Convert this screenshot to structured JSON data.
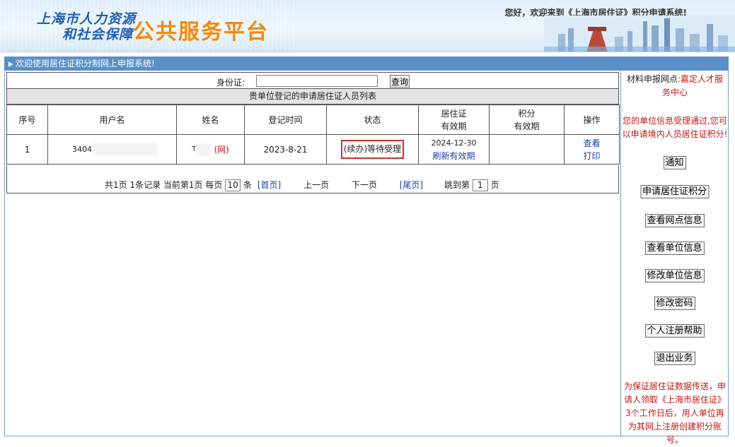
{
  "header": {
    "logo_line1": "上海市人力资源",
    "logo_line2": "和社会保障",
    "logo_main": "公共服务平台",
    "welcome": "您好，欢迎来到《上海市居住证》积分申请系统!"
  },
  "titlebar": {
    "text": "欢迎使用居住证积分制网上申报系统!"
  },
  "search": {
    "label": "身份证:",
    "value": "",
    "button": "查询"
  },
  "list_title": "贵单位登记的申请居住证人员列表",
  "table": {
    "headers": [
      "序号",
      "用户名",
      "姓名",
      "登记时间",
      "状态",
      "居住证有效期",
      "积分有效期",
      "操作"
    ],
    "headers_lines": {
      "permit_1": "居住证",
      "permit_2": "有效期",
      "score_1": "积分",
      "score_2": "有效期"
    },
    "rows": [
      {
        "index": "1",
        "username": "3404",
        "name": "T",
        "name_tag": "(网)",
        "reg_time": "2023-8-21",
        "status": "(续办)等待受理",
        "permit_expiry": "2024-12-30",
        "permit_refresh": "刷新有效期",
        "score_expiry": "",
        "op_view": "查看",
        "op_print": "打印"
      }
    ]
  },
  "pager": {
    "summary": "共1页 1条记录 当前第1页 每页",
    "page_size": "10",
    "unit": "条",
    "first": "[首页]",
    "prev": "上一页",
    "next": "下一页",
    "last": "[尾页]",
    "jump_label": "跳到第",
    "jump_value": "1",
    "page_unit": "页"
  },
  "sidebar": {
    "material_label": "材料申报网点:",
    "material_site": "嘉定人才服务中心",
    "notice": "您的单位信息受理通过,您可以申请境内人员居住证积分!",
    "buttons": [
      "通知",
      "申请居住证积分",
      "查看网点信息",
      "查看单位信息",
      "修改单位信息",
      "修改密码",
      "个人注册帮助",
      "退出业务"
    ],
    "footer_note": "为保证居住证数据传送，申请人领取《上海市居住证》3个工作日后，用人单位再为其网上注册创建积分账号。"
  },
  "colors": {
    "titlebar": "#5b8fc9",
    "accent_red": "#c81414",
    "link_blue": "#1a3fa8",
    "logo_orange": "#f08a12"
  }
}
